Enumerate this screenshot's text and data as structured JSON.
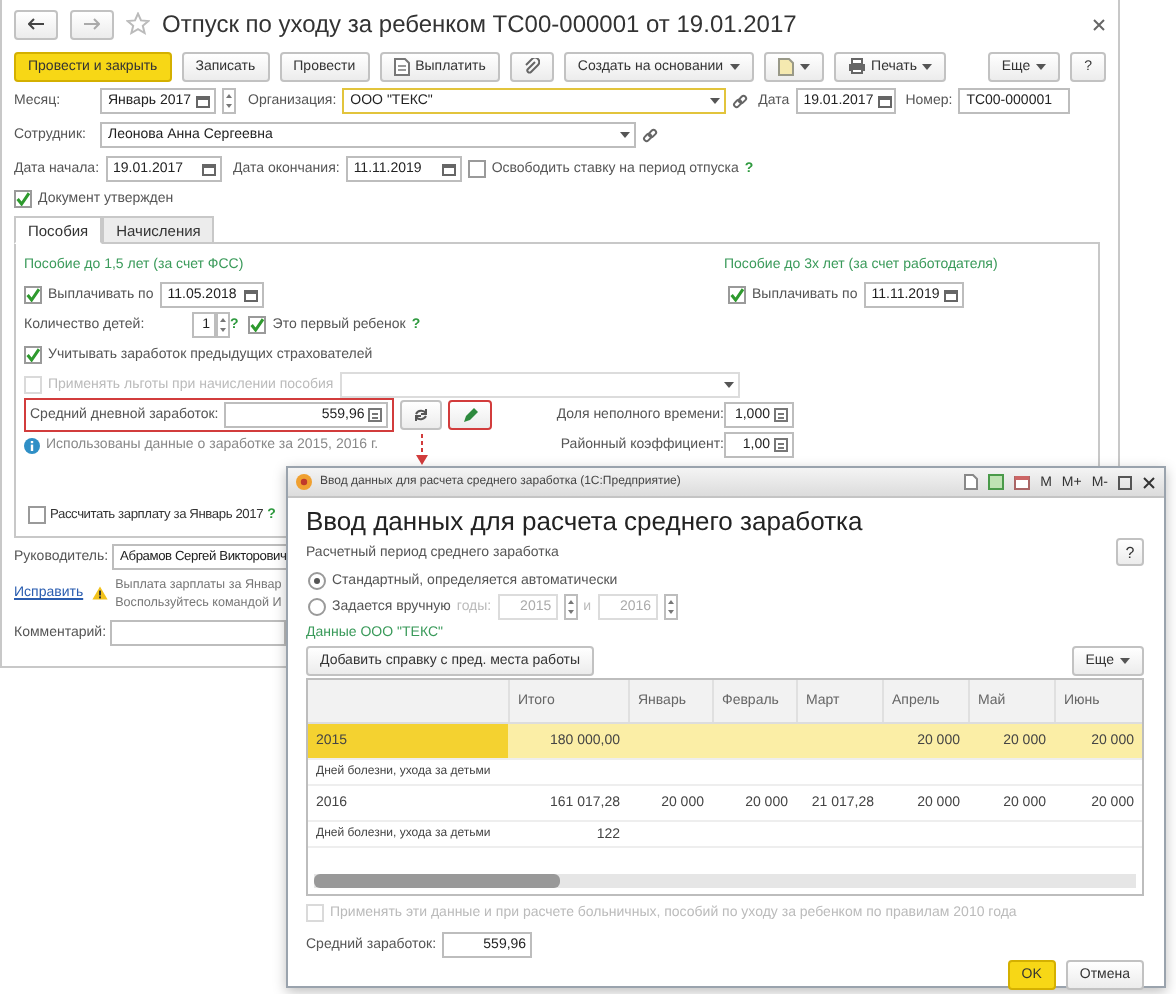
{
  "window": {
    "title": "Отпуск по уходу за ребенком ТС00-000001 от 19.01.2017"
  },
  "toolbar": {
    "post_close": "Провести и закрыть",
    "save": "Записать",
    "post": "Провести",
    "pay": "Выплатить",
    "create_based": "Создать на основании",
    "print": "Печать",
    "more": "Еще",
    "help": "?"
  },
  "header": {
    "month": {
      "label": "Месяц:",
      "value": "Январь 2017"
    },
    "organization": {
      "label": "Организация:",
      "value": "ООО \"ТЕКС\""
    },
    "date": {
      "label": "Дата",
      "value": "19.01.2017"
    },
    "number": {
      "label": "Номер:",
      "value": "ТС00-000001"
    },
    "employee": {
      "label": "Сотрудник:",
      "value": "Леонова Анна Сергеевна"
    },
    "start": {
      "label": "Дата начала:",
      "value": "19.01.2017"
    },
    "end": {
      "label": "Дата окончания:",
      "value": "11.11.2019"
    },
    "free_rate": {
      "label": "Освободить ставку на период отпуска",
      "checked": false,
      "help": "?"
    },
    "approved": {
      "label": "Документ утвержден",
      "checked": true
    }
  },
  "tabs": [
    {
      "label": "Пособия",
      "selected": true
    },
    {
      "label": "Начисления",
      "selected": false
    }
  ],
  "benefits": {
    "left_title": "Пособие до 1,5 лет (за счет ФСС)",
    "right_title": "Пособие до 3х лет (за счет работодателя)",
    "pay_until_left": {
      "label": "Выплачивать по",
      "checked": true,
      "value": "11.05.2018"
    },
    "pay_until_right": {
      "label": "Выплачивать по",
      "checked": true,
      "value": "11.11.2019"
    },
    "children": {
      "label": "Количество детей:",
      "value": "1",
      "help": "?"
    },
    "first_child": {
      "label": "Это первый ребенок",
      "checked": true,
      "help": "?"
    },
    "prev_insurers": {
      "label": "Учитывать заработок предыдущих страхователей",
      "checked": true
    },
    "privileges": {
      "label": "Применять льготы при начислении пособия",
      "checked": false,
      "disabled": true
    },
    "avg_daily": {
      "label": "Средний дневной заработок:",
      "value": "559,96"
    },
    "part_time": {
      "label": "Доля неполного времени:",
      "value": "1,000"
    },
    "regional": {
      "label": "Районный коэффициент:",
      "value": "1,00"
    },
    "info": "Использованы данные о заработке за  2015,  2016 г."
  },
  "calc_salary": {
    "label": "Рассчитать зарплату за Январь 2017",
    "checked": false,
    "help": "?"
  },
  "manager": {
    "label": "Руководитель:",
    "value": "Абрамов Сергей Викторович"
  },
  "warning": {
    "link": "Исправить",
    "lines": [
      "Выплата зарплаты за Январ",
      "Воспользуйтесь командой И"
    ]
  },
  "comment": {
    "label": "Комментарий:"
  },
  "dialog": {
    "window_title": "Ввод данных для расчета среднего заработка (1С:Предприятие)",
    "window_buttons": [
      "M",
      "M+",
      "M-"
    ],
    "heading": "Ввод данных для расчета среднего заработка",
    "help": "?",
    "period_label": "Расчетный период среднего заработка",
    "period_options": [
      {
        "label": "Стандартный, определяется автоматически",
        "selected": true
      },
      {
        "label": "Задается вручную",
        "selected": false
      }
    ],
    "years": {
      "label": "годы:",
      "from": "2015",
      "and": "и",
      "to": "2016",
      "disabled": true
    },
    "org_data": "Данные ООО \"ТЕКС\"",
    "add_button": "Добавить справку с пред. места работы",
    "more": "Еще",
    "table": {
      "columns": [
        "Итого",
        "Январь",
        "Февраль",
        "Март",
        "Апрель",
        "Май",
        "Июнь"
      ],
      "rows": [
        {
          "kind": "year",
          "label": "2015",
          "selected": true,
          "cells": [
            "180 000,00",
            null,
            null,
            null,
            "20 000",
            "20 000",
            "20 000"
          ]
        },
        {
          "kind": "days",
          "label": "Дней болезни, ухода за детьми",
          "selected": false
        },
        {
          "kind": "year",
          "label": "2016",
          "selected": false,
          "cells": [
            "161 017,28",
            "20 000",
            "20 000",
            "21 017,28",
            "20 000",
            "20 000",
            "20 000"
          ]
        },
        {
          "kind": "days",
          "label": "Дней болезни, ухода за детьми",
          "selected": false,
          "cells": [
            "122"
          ]
        }
      ]
    },
    "apply_2010": {
      "label": "Применять эти данные и при расчете больничных, пособий по уходу за ребенком по правилам 2010 года",
      "checked": false,
      "disabled": true
    },
    "avg": {
      "label": "Средний заработок:",
      "value": "559,96"
    },
    "ok": "OK",
    "cancel": "Отмена"
  }
}
